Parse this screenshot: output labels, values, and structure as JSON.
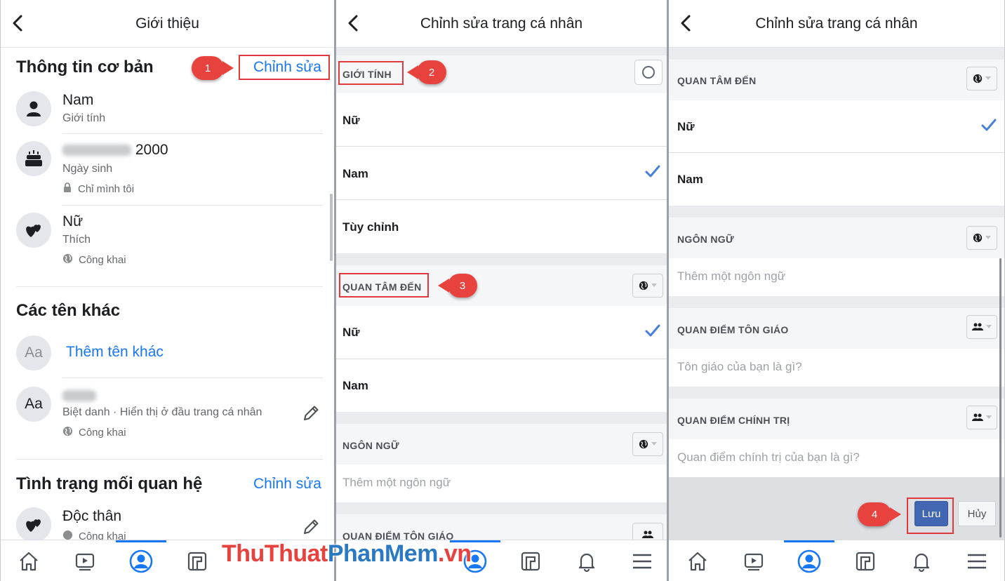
{
  "panel1": {
    "title": "Giới thiệu",
    "basic_info": {
      "heading": "Thông tin cơ bản",
      "edit_link": "Chỉnh sửa",
      "gender": {
        "value": "Nam",
        "label": "Giới tính"
      },
      "birthday": {
        "value_visible": "2000",
        "label": "Ngày sinh",
        "privacy": "Chỉ mình tôi"
      },
      "interested": {
        "value": "Nữ",
        "label": "Thích",
        "privacy": "Công khai"
      }
    },
    "other_names": {
      "heading": "Các tên khác",
      "add_label": "Thêm tên khác",
      "avatar_text": "Aa",
      "nickname_desc": "Biệt danh · Hiển thị ở đầu trang cá nhân",
      "nickname_privacy": "Công khai"
    },
    "relationship": {
      "heading": "Tình trạng mối quan hệ",
      "edit_link": "Chỉnh sửa",
      "value": "Độc thân",
      "privacy": "Công khai"
    }
  },
  "panel2": {
    "title": "Chỉnh sửa trang cá nhân",
    "gender_section": {
      "label": "GIỚI TÍNH",
      "options": [
        "Nữ",
        "Nam",
        "Tùy chỉnh"
      ],
      "selected": "Nam"
    },
    "interested_section": {
      "label": "QUAN TÂM ĐẾN",
      "options": [
        "Nữ",
        "Nam"
      ],
      "selected": "Nữ"
    },
    "language_section": {
      "label": "NGÔN NGỮ",
      "placeholder": "Thêm một ngôn ngữ"
    },
    "religion_section": {
      "label": "QUAN ĐIỂM TÔN GIÁO"
    }
  },
  "panel3": {
    "title": "Chỉnh sửa trang cá nhân",
    "interested_section": {
      "label": "QUAN TÂM ĐẾN",
      "options": [
        "Nữ",
        "Nam"
      ],
      "selected": "Nữ"
    },
    "language_section": {
      "label": "NGÔN NGỮ",
      "placeholder": "Thêm một ngôn ngữ"
    },
    "religion_section": {
      "label": "QUAN ĐIỂM TÔN GIÁO",
      "placeholder": "Tôn giáo của bạn là gì?"
    },
    "political_section": {
      "label": "QUAN ĐIỂM CHÍNH TRỊ",
      "placeholder": "Quan điểm chính trị của bạn là gì?"
    },
    "save_label": "Lưu",
    "cancel_label": "Hủy"
  },
  "annotations": {
    "step1": "1",
    "step2": "2",
    "step3": "3",
    "step4": "4"
  },
  "watermark": {
    "part1": "ThuThuat",
    "part2": "PhanMem",
    "part3": ".vn"
  },
  "colors": {
    "accent": "#1877f2",
    "annotation_red": "#e0393e",
    "save_blue": "#4267b2",
    "check_blue": "#4a7fd8"
  },
  "icons": [
    "back-chevron-icon",
    "person-icon",
    "cake-icon",
    "hearts-icon",
    "lock-icon",
    "globe-icon",
    "pencil-icon",
    "checkmark-icon",
    "radio-circle-icon",
    "friends-icon",
    "home-icon",
    "watch-icon",
    "profile-icon",
    "pages-icon",
    "bell-icon",
    "menu-icon"
  ]
}
